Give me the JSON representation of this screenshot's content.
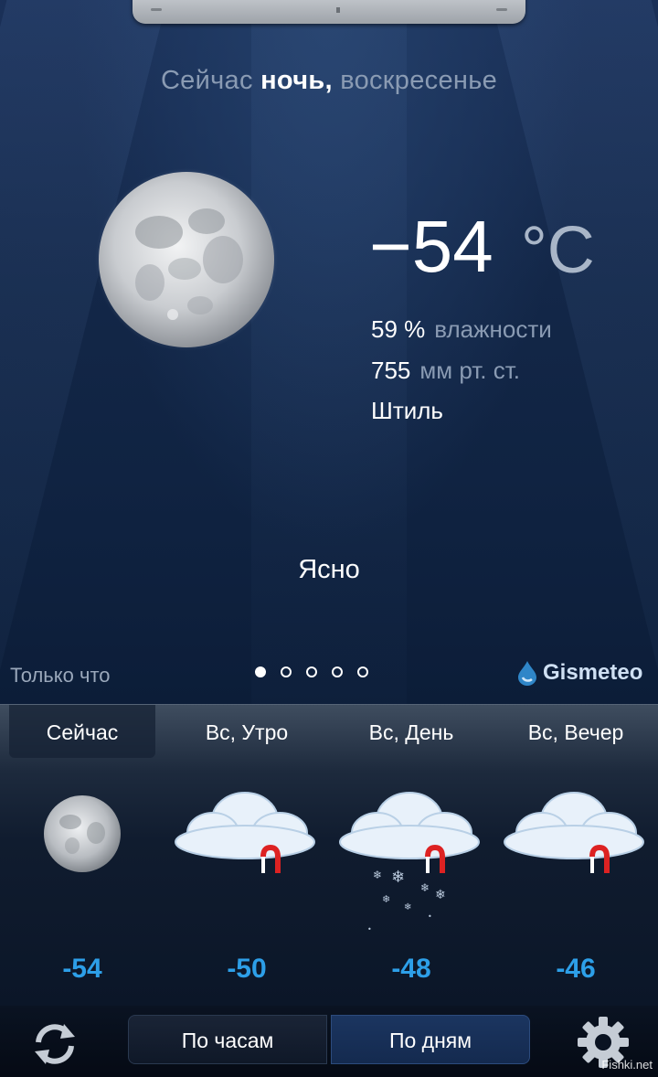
{
  "header": {
    "now_prefix": "Сейчас",
    "now_time_of_day": "ночь,",
    "now_day": "воскресенье"
  },
  "current": {
    "temperature": "−54",
    "unit": "°C",
    "humidity_value": "59 %",
    "humidity_label": "влажности",
    "pressure_value": "755",
    "pressure_label": "мм рт. ст.",
    "wind": "Штиль",
    "condition": "Ясно",
    "icon": "moon-icon"
  },
  "status": {
    "updated": "Только что",
    "brand": "Gismeteo",
    "pager": {
      "count": 5,
      "active_index": 0
    }
  },
  "forecast": {
    "tabs": [
      {
        "label": "Сейчас",
        "active": true,
        "temp": "-54",
        "icon": "moon-icon"
      },
      {
        "label": "Вс, Утро",
        "active": false,
        "temp": "-50",
        "icon": "cloud-icon"
      },
      {
        "label": "Вс, День",
        "active": false,
        "temp": "-48",
        "icon": "cloud-snow-icon"
      },
      {
        "label": "Вс, Вечер",
        "active": false,
        "temp": "-46",
        "icon": "cloud-icon"
      }
    ],
    "temp_color": "#2d9fe8"
  },
  "bottom_bar": {
    "hourly_label": "По часам",
    "daily_label": "По дням",
    "active": "daily",
    "refresh_icon": "refresh-icon",
    "settings_icon": "gear-icon"
  },
  "watermark": "Fishki.net"
}
